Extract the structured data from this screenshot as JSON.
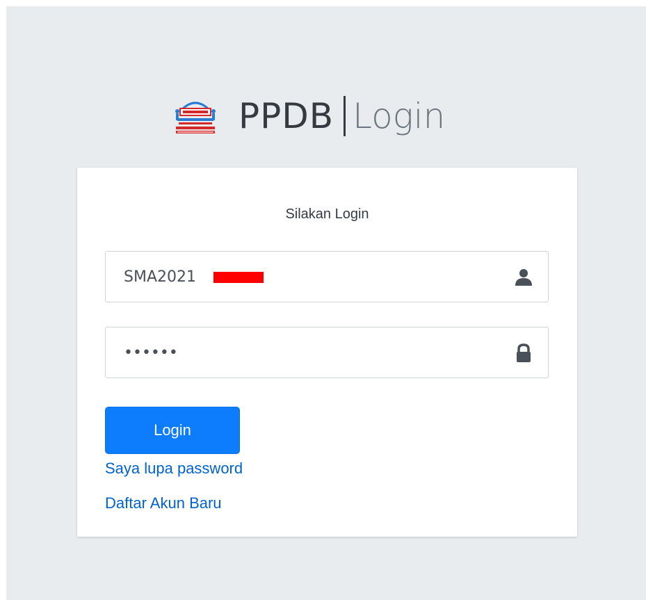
{
  "header": {
    "brand_name": "PPDB",
    "brand_page": "Login"
  },
  "login_card": {
    "title": "Silakan Login",
    "username": {
      "value": "SMA2021",
      "icon": "user-icon"
    },
    "password": {
      "value": "••••••",
      "icon": "lock-icon"
    },
    "login_button_label": "Login",
    "forgot_password_link": "Saya lupa password",
    "register_link": "Daftar Akun Baru"
  },
  "colors": {
    "page_background": "#e9ecef",
    "card_background": "#ffffff",
    "primary_button": "#0d7dfd",
    "link": "#0062cc",
    "redaction": "#ff0000"
  }
}
